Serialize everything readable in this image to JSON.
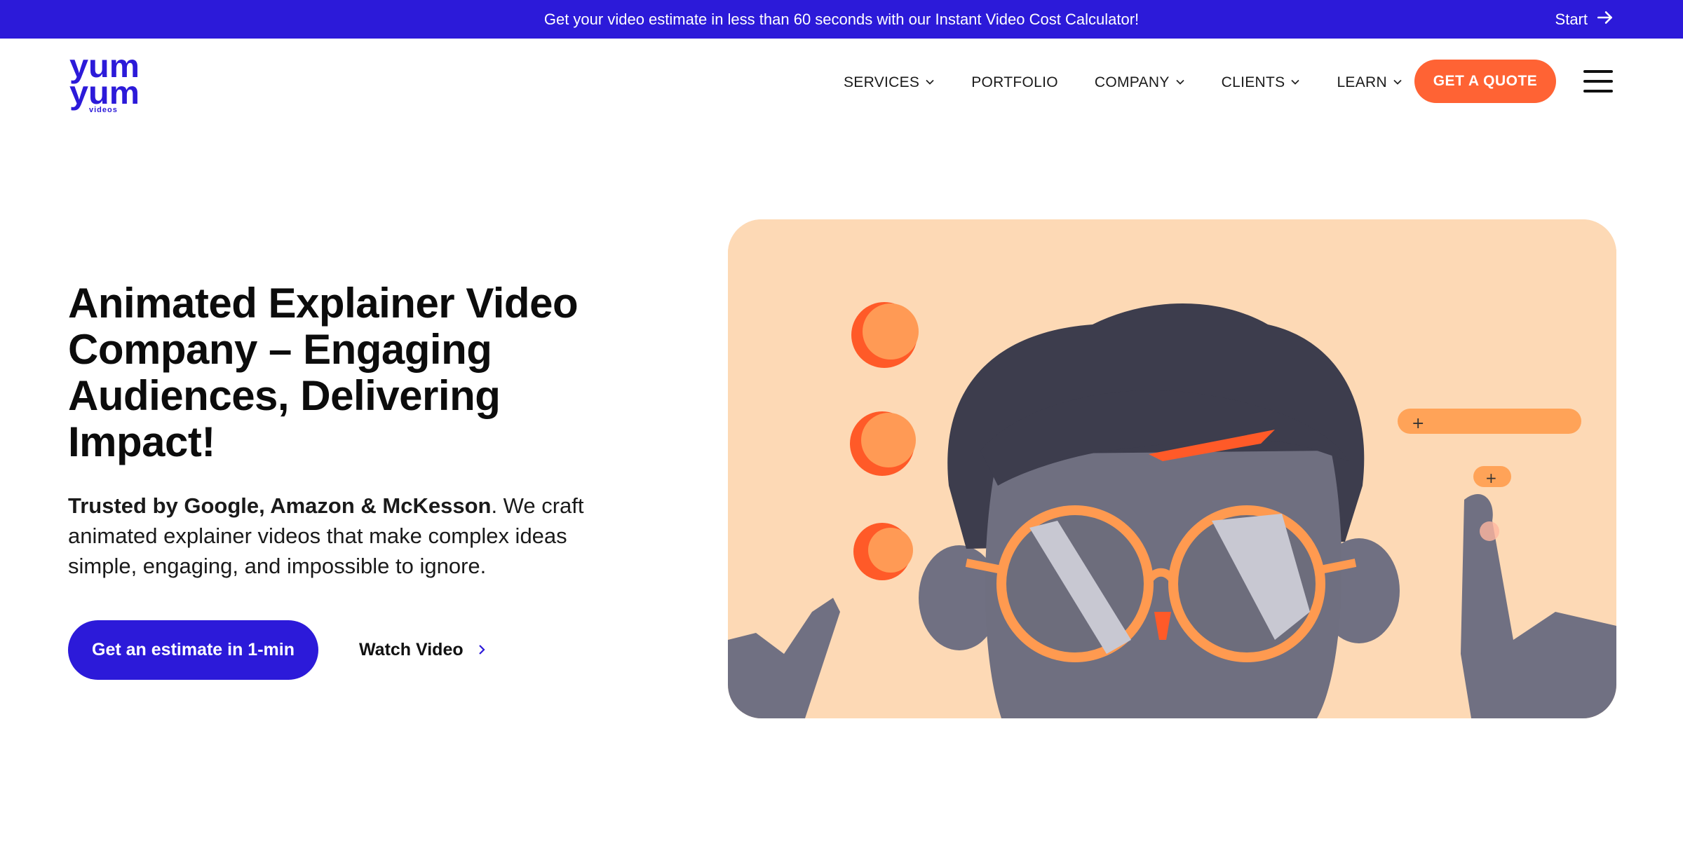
{
  "announcement": {
    "text": "Get your video estimate in less than 60 seconds with our Instant Video Cost Calculator!",
    "start_label": "Start"
  },
  "logo": {
    "lines": [
      "yum",
      "yum",
      "videos"
    ]
  },
  "nav": {
    "items": [
      {
        "label": "SERVICES",
        "has_dropdown": true
      },
      {
        "label": "PORTFOLIO",
        "has_dropdown": false
      },
      {
        "label": "COMPANY",
        "has_dropdown": true
      },
      {
        "label": "CLIENTS",
        "has_dropdown": true
      },
      {
        "label": "LEARN",
        "has_dropdown": true
      }
    ],
    "quote_label": "GET A QUOTE"
  },
  "hero": {
    "title": "Animated Explainer Video Company – Engaging Audiences, Delivering Impact!",
    "text_bold": "Trusted by Google, Amazon & McKesson",
    "text_rest": ". We craft animated explainer videos that make complex ideas simple, engaging, and impossible to ignore.",
    "primary_cta": "Get an estimate in 1-min",
    "secondary_cta": "Watch Video"
  },
  "colors": {
    "brand_blue": "#2c1ad9",
    "accent_orange": "#ff6334",
    "illustration_bg": "#fdd9b5"
  },
  "icons": {
    "start_arrow": "arrow-right-icon",
    "dropdown": "chevron-down-icon",
    "menu": "hamburger-menu-icon",
    "watch_video": "chevron-right-icon"
  }
}
